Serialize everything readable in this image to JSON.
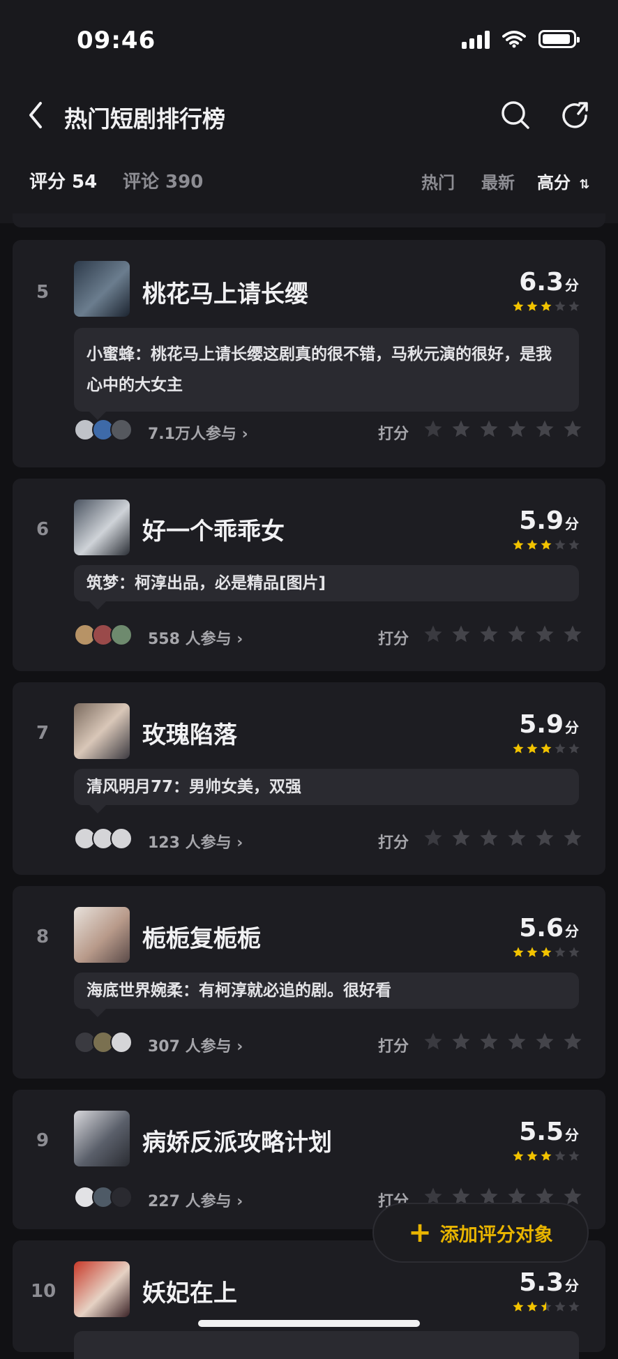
{
  "status": {
    "time": "09:46"
  },
  "header": {
    "title": "热门短剧排行榜",
    "back_icon": "chevron-left-icon",
    "search_icon": "search-icon",
    "share_icon": "share-icon"
  },
  "tabs": {
    "score": "评分 54",
    "comment": "评论 390",
    "sort_hot": "热门",
    "sort_new": "最新",
    "sort_high": "高分",
    "sort_icon": "sort-icon"
  },
  "colors": {
    "background": "#111114",
    "card": "#1d1d22",
    "bubble": "#2a2a30",
    "star": "#f2c300",
    "accent": "#e8b400"
  },
  "rate_label": "打分",
  "items": [
    {
      "rank": "5",
      "title": "桃花马上请长缨",
      "score": "6.3",
      "unit": "分",
      "stars": 3,
      "comment": "小蜜蜂：桃花马上请长缨这剧真的很不错，马秋元演的很好，是我心中的大女主",
      "participants": "7.1万人参与"
    },
    {
      "rank": "6",
      "title": "好一个乖乖女",
      "score": "5.9",
      "unit": "分",
      "stars": 3,
      "comment": "筑梦：柯淳出品，必是精品[图片]",
      "participants": "558 人参与"
    },
    {
      "rank": "7",
      "title": "玫瑰陷落",
      "score": "5.9",
      "unit": "分",
      "stars": 3,
      "comment": "清风明月77：男帅女美，双强",
      "participants": "123 人参与"
    },
    {
      "rank": "8",
      "title": "栀栀复栀栀",
      "score": "5.6",
      "unit": "分",
      "stars": 3,
      "comment": "海底世界婉柔：有柯淳就必追的剧。很好看",
      "participants": "307 人参与"
    },
    {
      "rank": "9",
      "title": "病娇反派攻略计划",
      "score": "5.5",
      "unit": "分",
      "stars": 3,
      "comment": "",
      "participants": "227 人参与"
    },
    {
      "rank": "10",
      "title": "妖妃在上",
      "score": "5.3",
      "unit": "分",
      "stars": 2.5,
      "comment": "",
      "participants": ""
    }
  ],
  "fab": {
    "label": "添加评分对象",
    "icon": "plus-icon"
  }
}
